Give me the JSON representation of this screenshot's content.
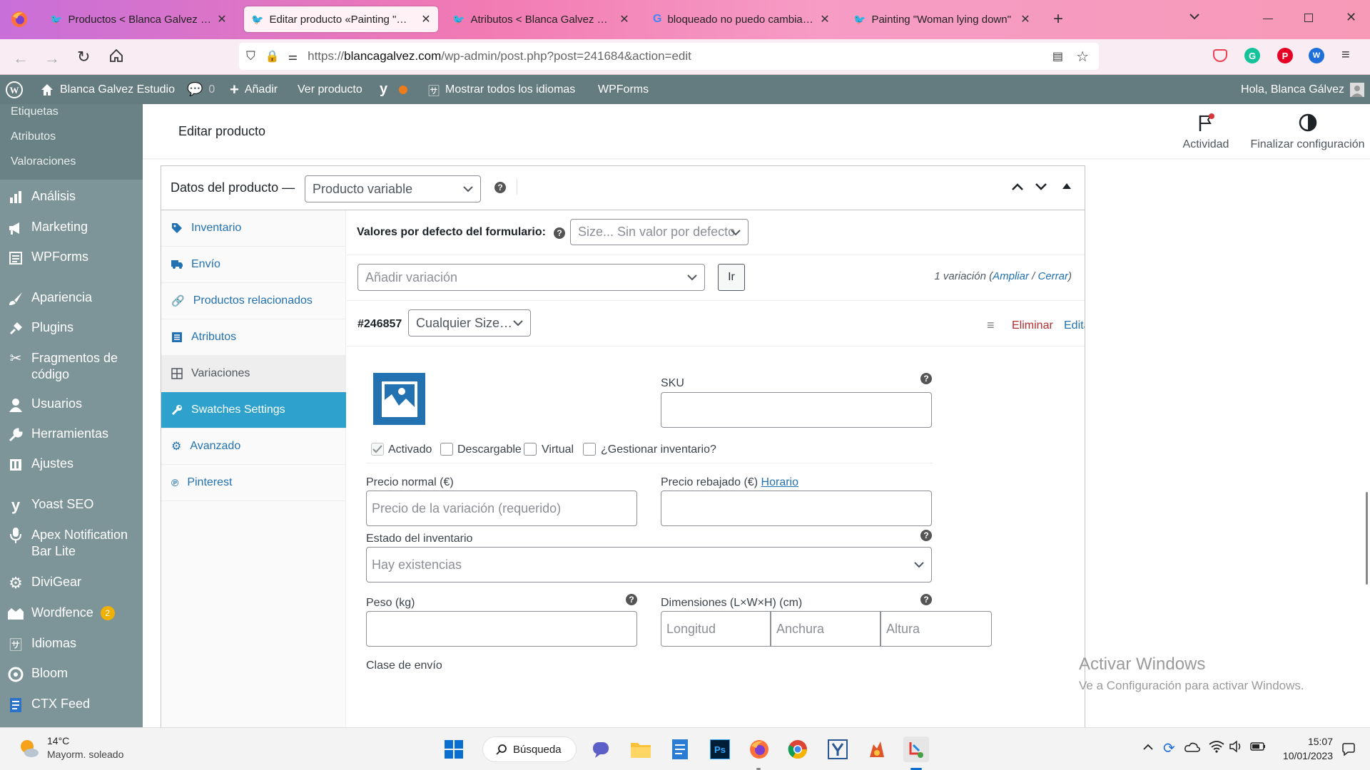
{
  "browser": {
    "tabs": [
      {
        "title": "Productos < Blanca Galvez Estudio",
        "active": false
      },
      {
        "title": "Editar producto «Painting \"Woman lying down\"",
        "active": true
      },
      {
        "title": "Atributos < Blanca Galvez Estudio",
        "active": false
      },
      {
        "title": "bloqueado no puedo cambiar variaciones",
        "active": false
      },
      {
        "title": "Painting \"Woman lying down\"",
        "active": false
      }
    ],
    "url_prefix": "https://",
    "url_host": "blancagalvez.com",
    "url_path": "/wp-admin/post.php?post=241684&action=edit"
  },
  "adminbar": {
    "site_name": "Blanca Galvez Estudio",
    "comments_count": "0",
    "add_label": "Añadir",
    "view_product": "Ver producto",
    "languages": "Mostrar todos los idiomas",
    "wpforms": "WPForms",
    "greeting": "Hola, Blanca Gálvez"
  },
  "sidebar": {
    "subitems": [
      "Etiquetas",
      "Atributos",
      "Valoraciones"
    ],
    "items": [
      {
        "label": "Análisis",
        "icon": "chart-icon"
      },
      {
        "label": "Marketing",
        "icon": "megaphone-icon"
      },
      {
        "label": "WPForms",
        "icon": "form-icon"
      },
      {
        "label": "Apariencia",
        "icon": "brush-icon"
      },
      {
        "label": "Plugins",
        "icon": "plugin-icon"
      },
      {
        "label": "Fragmentos de código",
        "icon": "scissors-icon"
      },
      {
        "label": "Usuarios",
        "icon": "user-icon"
      },
      {
        "label": "Herramientas",
        "icon": "wrench-icon"
      },
      {
        "label": "Ajustes",
        "icon": "settings-icon"
      },
      {
        "label": "Yoast SEO",
        "icon": "yoast-icon"
      },
      {
        "label": "Apex Notification Bar Lite",
        "icon": "microphone-icon"
      },
      {
        "label": "DiviGear",
        "icon": "gear-icon"
      },
      {
        "label": "Wordfence",
        "icon": "wordfence-icon",
        "badge": "2"
      },
      {
        "label": "Idiomas",
        "icon": "translate-icon"
      },
      {
        "label": "Bloom",
        "icon": "bloom-icon"
      },
      {
        "label": "CTX Feed",
        "icon": "feed-icon"
      }
    ]
  },
  "header": {
    "title": "Editar producto",
    "activity": "Actividad",
    "finish_setup": "Finalizar configuración"
  },
  "product_data": {
    "title": "Datos del producto —",
    "type_select": "Producto variable",
    "tabs": [
      {
        "label": "Inventario",
        "icon": "tag-icon"
      },
      {
        "label": "Envío",
        "icon": "truck-icon"
      },
      {
        "label": "Productos relacionados",
        "icon": "link-icon"
      },
      {
        "label": "Atributos",
        "icon": "list-icon"
      },
      {
        "label": "Variaciones",
        "icon": "grid-icon"
      },
      {
        "label": "Swatches Settings",
        "icon": "wrench-icon"
      },
      {
        "label": "Avanzado",
        "icon": "gear-icon"
      },
      {
        "label": "Pinterest",
        "icon": "pinterest-icon"
      }
    ],
    "defaults_label": "Valores por defecto del formulario:",
    "defaults_select": "Size... Sin valor por defecto",
    "add_variation_select": "Añadir variación",
    "go_button": "Ir",
    "variation_count_text": "1 variación (",
    "expand": "Ampliar",
    "separator": " / ",
    "close": "Cerrar",
    "variation_close_paren": ")",
    "variation": {
      "id": "#246857",
      "size_select": "Cualquier Size…",
      "remove": "Eliminar",
      "edit": "Editar",
      "sku_label": "SKU",
      "checkboxes": [
        {
          "label": "Activado",
          "checked": true
        },
        {
          "label": "Descargable",
          "checked": false
        },
        {
          "label": "Virtual",
          "checked": false
        },
        {
          "label": "¿Gestionar inventario?",
          "checked": false
        }
      ],
      "regular_price_label": "Precio normal (€)",
      "regular_price_placeholder": "Precio de la variación (requerido)",
      "sale_price_label": "Precio rebajado (€)",
      "schedule_link": "Horario",
      "stock_status_label": "Estado del inventario",
      "stock_status_value": "Hay existencias",
      "weight_label": "Peso (kg)",
      "dimensions_label": "Dimensiones (L×W×H) (cm)",
      "length_placeholder": "Longitud",
      "width_placeholder": "Anchura",
      "height_placeholder": "Altura",
      "shipping_class_label": "Clase de envío"
    }
  },
  "watermark": {
    "title": "Activar Windows",
    "subtitle": "Ve a Configuración para activar Windows."
  },
  "taskbar": {
    "weather_temp": "14°C",
    "weather_desc": "Mayorm. soleado",
    "search": "Búsqueda",
    "time": "15:07",
    "date": "10/01/2023"
  }
}
